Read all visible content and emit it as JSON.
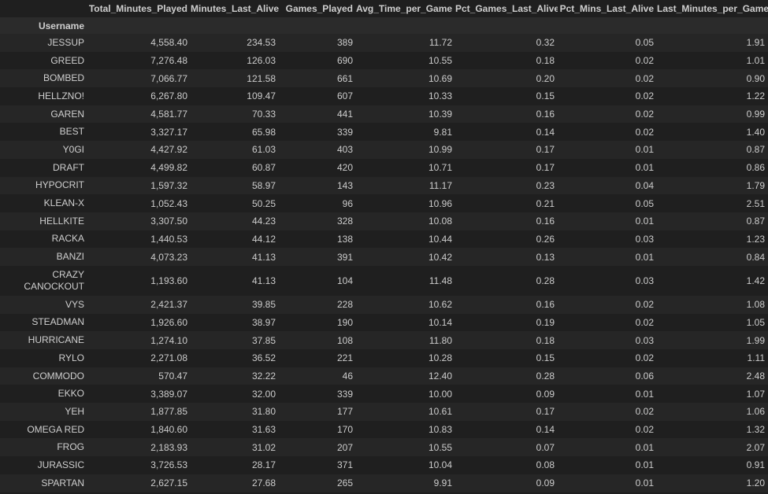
{
  "table": {
    "columns": [
      "",
      "Total_Minutes_Played",
      "Minutes_Last_Alive",
      "Games_Played",
      "Avg_Time_per_Game",
      "Pct_Games_Last_Alive",
      "Pct_Mins_Last_Alive",
      "Last_Minutes_per_Game"
    ],
    "index_name": "Username",
    "rows": [
      [
        "JESSUP",
        "4,558.40",
        "234.53",
        "389",
        "11.72",
        "0.32",
        "0.05",
        "1.91"
      ],
      [
        "GREED",
        "7,276.48",
        "126.03",
        "690",
        "10.55",
        "0.18",
        "0.02",
        "1.01"
      ],
      [
        "BOMBED",
        "7,066.77",
        "121.58",
        "661",
        "10.69",
        "0.20",
        "0.02",
        "0.90"
      ],
      [
        "HELLZNO!",
        "6,267.80",
        "109.47",
        "607",
        "10.33",
        "0.15",
        "0.02",
        "1.22"
      ],
      [
        "GAREN",
        "4,581.77",
        "70.33",
        "441",
        "10.39",
        "0.16",
        "0.02",
        "0.99"
      ],
      [
        "BEST",
        "3,327.17",
        "65.98",
        "339",
        "9.81",
        "0.14",
        "0.02",
        "1.40"
      ],
      [
        "Y0GI",
        "4,427.92",
        "61.03",
        "403",
        "10.99",
        "0.17",
        "0.01",
        "0.87"
      ],
      [
        "DRAFT",
        "4,499.82",
        "60.87",
        "420",
        "10.71",
        "0.17",
        "0.01",
        "0.86"
      ],
      [
        "HYPOCRIT",
        "1,597.32",
        "58.97",
        "143",
        "11.17",
        "0.23",
        "0.04",
        "1.79"
      ],
      [
        "KLEAN-X",
        "1,052.43",
        "50.25",
        "96",
        "10.96",
        "0.21",
        "0.05",
        "2.51"
      ],
      [
        "HELLKITE",
        "3,307.50",
        "44.23",
        "328",
        "10.08",
        "0.16",
        "0.01",
        "0.87"
      ],
      [
        "RACKA",
        "1,440.53",
        "44.12",
        "138",
        "10.44",
        "0.26",
        "0.03",
        "1.23"
      ],
      [
        "BANZI",
        "4,073.23",
        "41.13",
        "391",
        "10.42",
        "0.13",
        "0.01",
        "0.84"
      ],
      [
        "CRAZY CANOCKOUT",
        "1,193.60",
        "41.13",
        "104",
        "11.48",
        "0.28",
        "0.03",
        "1.42"
      ],
      [
        "VYS",
        "2,421.37",
        "39.85",
        "228",
        "10.62",
        "0.16",
        "0.02",
        "1.08"
      ],
      [
        "STEADMAN",
        "1,926.60",
        "38.97",
        "190",
        "10.14",
        "0.19",
        "0.02",
        "1.05"
      ],
      [
        "HURRICANE",
        "1,274.10",
        "37.85",
        "108",
        "11.80",
        "0.18",
        "0.03",
        "1.99"
      ],
      [
        "RYLO",
        "2,271.08",
        "36.52",
        "221",
        "10.28",
        "0.15",
        "0.02",
        "1.11"
      ],
      [
        "COMMODO",
        "570.47",
        "32.22",
        "46",
        "12.40",
        "0.28",
        "0.06",
        "2.48"
      ],
      [
        "EKKO",
        "3,389.07",
        "32.00",
        "339",
        "10.00",
        "0.09",
        "0.01",
        "1.07"
      ],
      [
        "YEH",
        "1,877.85",
        "31.80",
        "177",
        "10.61",
        "0.17",
        "0.02",
        "1.06"
      ],
      [
        "OMEGA RED",
        "1,840.60",
        "31.63",
        "170",
        "10.83",
        "0.14",
        "0.02",
        "1.32"
      ],
      [
        "FROG",
        "2,183.93",
        "31.02",
        "207",
        "10.55",
        "0.07",
        "0.01",
        "2.07"
      ],
      [
        "JURASSIC",
        "3,726.53",
        "28.17",
        "371",
        "10.04",
        "0.08",
        "0.01",
        "0.91"
      ],
      [
        "SPARTAN",
        "2,627.15",
        "27.68",
        "265",
        "9.91",
        "0.09",
        "0.01",
        "1.20"
      ]
    ]
  }
}
